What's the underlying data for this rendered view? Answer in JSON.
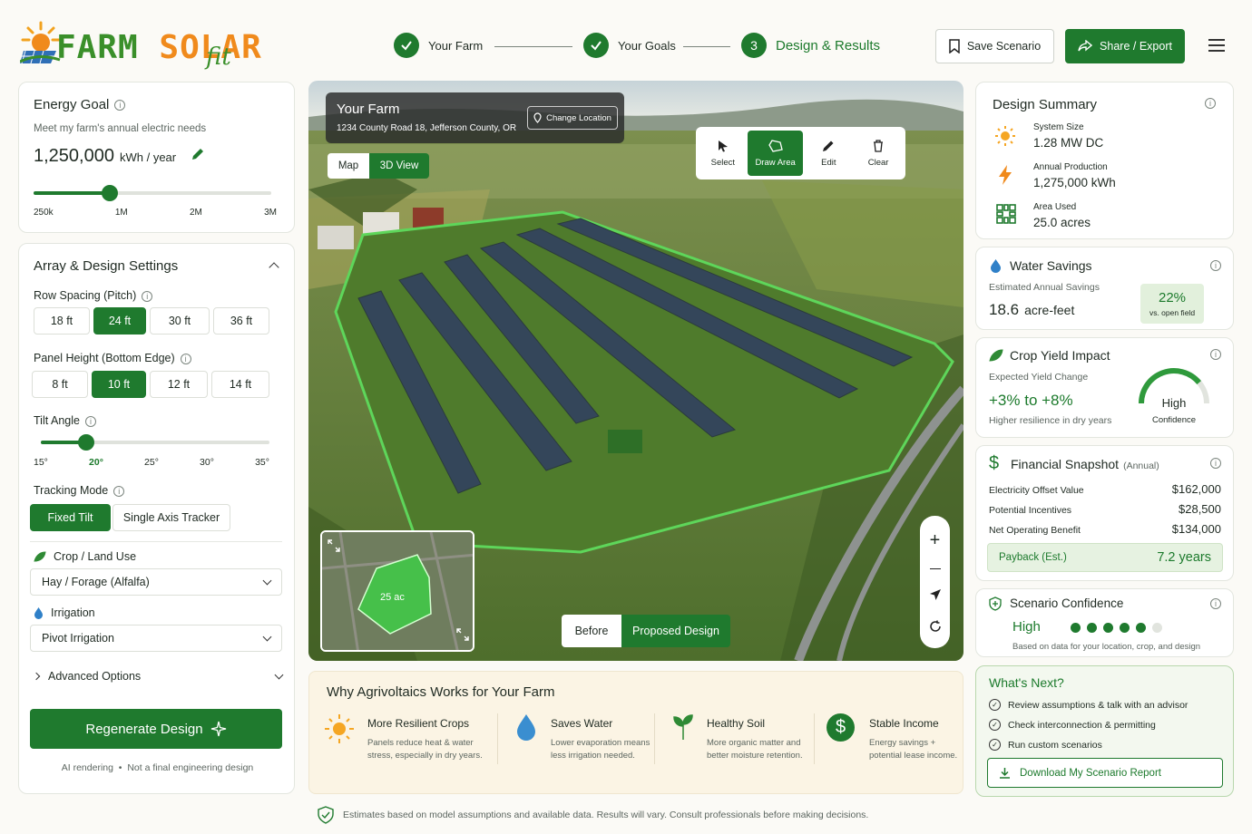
{
  "brand": {
    "word1": "FARM",
    "word2": "SOLAR",
    "word3": "fit"
  },
  "steps": [
    {
      "label": "Your Farm",
      "icon": "check-icon"
    },
    {
      "label": "Your Goals",
      "icon": "check-icon"
    },
    {
      "num": "3",
      "label": "Design & Results"
    }
  ],
  "header": {
    "save_label": "Save Scenario",
    "share_label": "Share / Export"
  },
  "energy": {
    "title": "Energy Goal",
    "subtitle": "Meet my farm's annual electric needs",
    "value": "1,250,000",
    "unit": "kWh / year",
    "slider_fraction": 0.32,
    "ticks": [
      "250k",
      "1M",
      "2M",
      "3M"
    ]
  },
  "array": {
    "title": "Array & Design Settings",
    "row_spacing": {
      "label": "Row Spacing (Pitch)",
      "options": [
        "18 ft",
        "24 ft",
        "30 ft",
        "36 ft"
      ],
      "selected": 1
    },
    "panel_height": {
      "label": "Panel Height (Bottom Edge)",
      "options": [
        "8 ft",
        "10 ft",
        "12 ft",
        "14 ft"
      ],
      "selected": 1
    },
    "tilt": {
      "label": "Tilt Angle",
      "ticks": [
        "15°",
        "20°",
        "25°",
        "30°",
        "35°"
      ],
      "selected": 1,
      "fraction": 0.2
    },
    "tracking": {
      "label": "Tracking Mode",
      "options": [
        "Fixed Tilt",
        "Single Axis Tracker"
      ],
      "selected": 0
    },
    "crop": {
      "label": "Crop / Land Use",
      "value": "Hay / Forage (Alfalfa)"
    },
    "irrigation": {
      "label": "Irrigation",
      "value": "Pivot Irrigation"
    },
    "advanced": "Advanced Options"
  },
  "regen": {
    "label": "Regenerate Design",
    "note1": "AI rendering",
    "note2": "Not a final engineering design"
  },
  "map": {
    "farm_title": "Your Farm",
    "address": "1234 County Road 18, Jefferson County, OR",
    "change_location": "Change Location",
    "view_map": "Map",
    "view_3d": "3D View",
    "tools": [
      {
        "label": "Select",
        "icon": "cursor-icon"
      },
      {
        "label": "Draw Area",
        "icon": "draw-area-icon"
      },
      {
        "label": "Edit",
        "icon": "pencil-icon"
      },
      {
        "label": "Clear",
        "icon": "trash-icon"
      }
    ],
    "minimap_label": "25 ac",
    "before": "Before",
    "proposed": "Proposed Design"
  },
  "why": {
    "title": "Why Agrivoltaics Works for Your Farm",
    "items": [
      {
        "title": "More Resilient Crops",
        "desc": "Panels reduce heat & water stress, especially in dry years.",
        "icon": "sun-icon"
      },
      {
        "title": "Saves Water",
        "desc": "Lower evaporation means less irrigation needed.",
        "icon": "water-drop-icon"
      },
      {
        "title": "Healthy Soil",
        "desc": "More organic matter and better moisture retention.",
        "icon": "sprout-icon"
      },
      {
        "title": "Stable Income",
        "desc": "Energy savings + potential lease income.",
        "icon": "dollar-icon"
      }
    ]
  },
  "disclaimer": "Estimates based on model assumptions and available data. Results will vary. Consult professionals before making decisions.",
  "summary": {
    "title": "Design Summary",
    "rows": [
      {
        "label": "System Size",
        "value": "1.28 MW DC",
        "icon": "sun-icon"
      },
      {
        "label": "Annual Production",
        "value": "1,275,000 kWh",
        "icon": "bolt-icon"
      },
      {
        "label": "Area Used",
        "value": "25.0 acres",
        "icon": "grid-icon"
      }
    ]
  },
  "water": {
    "title": "Water Savings",
    "label": "Estimated Annual Savings",
    "value": "18.6",
    "unit": "acre-feet",
    "pct": "22%",
    "pct_note": "vs. open field"
  },
  "crop_yield": {
    "title": "Crop Yield Impact",
    "label": "Expected Yield Change",
    "value": "+3% to +8%",
    "note": "Higher resilience in dry years",
    "gauge_label": "High",
    "gauge_note": "Confidence",
    "gauge_fraction": 0.78
  },
  "financial": {
    "title": "Financial Snapshot",
    "annual": "(Annual)",
    "rows": [
      {
        "label": "Electricity Offset Value",
        "value": "$162,000"
      },
      {
        "label": "Potential Incentives",
        "value": "$28,500"
      },
      {
        "label": "Net Operating Benefit",
        "value": "$134,000"
      }
    ],
    "payback_label": "Payback (Est.)",
    "payback_value": "7.2 years"
  },
  "confidence": {
    "title": "Scenario Confidence",
    "level": "High",
    "dots_filled": 5,
    "dots_total": 6,
    "note": "Based on data for your location, crop, and design"
  },
  "next": {
    "title": "What's Next?",
    "items": [
      "Review assumptions & talk with an advisor",
      "Check interconnection & permitting",
      "Run custom scenarios"
    ],
    "download": "Download My Scenario Report"
  },
  "colors": {
    "accent": "#1f7a2e",
    "brand_orange": "#f08a1c",
    "brand_green": "#3a8f2a"
  }
}
